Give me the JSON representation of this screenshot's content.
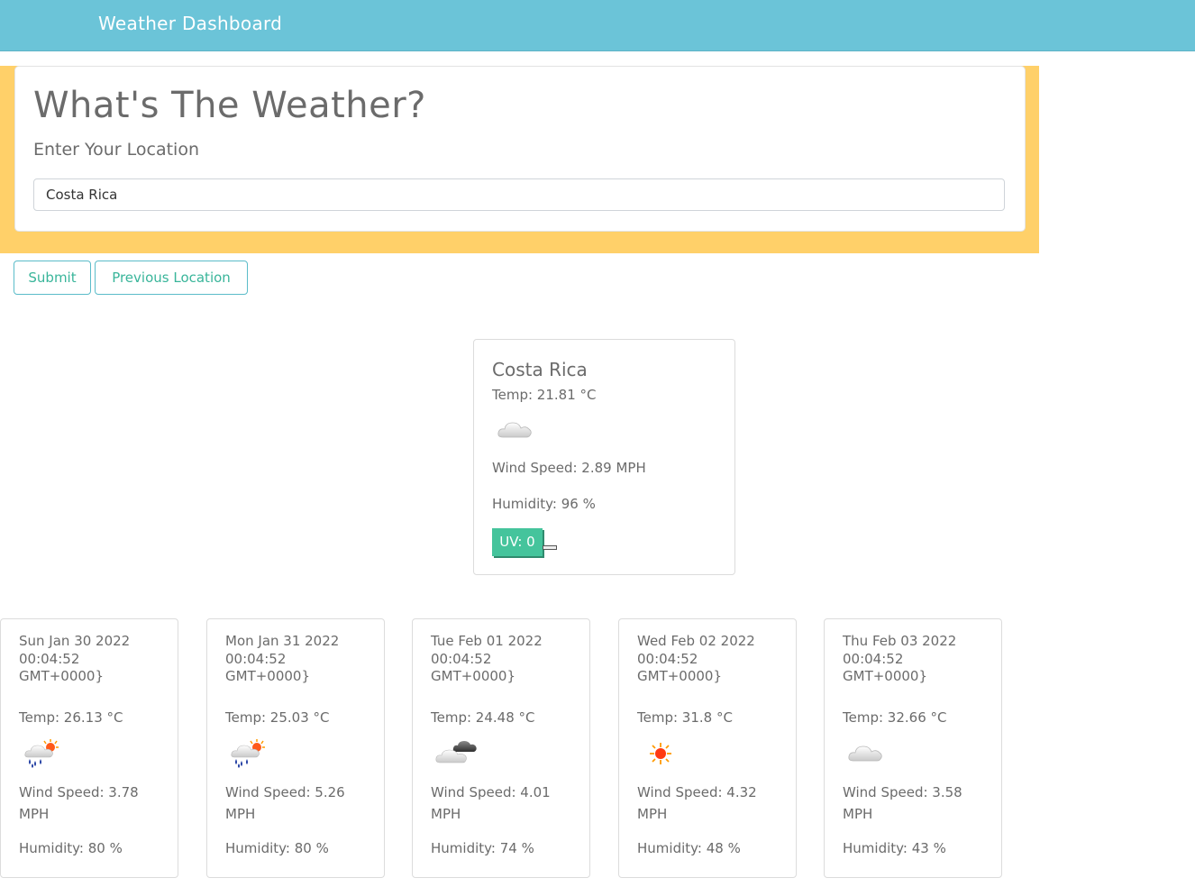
{
  "navbar": {
    "title": "Weather Dashboard"
  },
  "search": {
    "heading": "What's The Weather?",
    "label": "Enter Your Location",
    "input_value": "Costa Rica"
  },
  "buttons": {
    "submit": "Submit",
    "previous": "Previous Location"
  },
  "colors": {
    "navbar": "#6bc4d8",
    "jumbotron": "#ffd069",
    "button_text": "#39b59a",
    "uv_badge": "#45c49c"
  },
  "current": {
    "city": "Costa Rica",
    "temp": "Temp: 21.81 °C",
    "icon": "cloud-icon",
    "wind": "Wind Speed: 2.89 MPH",
    "humidity": "Humidity: 96 %",
    "uv": "UV: 0"
  },
  "forecast": [
    {
      "date": "Sun Jan 30 2022 00:04:52 GMT+0000}",
      "temp": "Temp: 26.13 °C",
      "icon": "rain-sun-icon",
      "wind": "Wind Speed: 3.78 MPH",
      "humidity": "Humidity: 80 %"
    },
    {
      "date": "Mon Jan 31 2022 00:04:52 GMT+0000}",
      "temp": "Temp: 25.03 °C",
      "icon": "rain-sun-icon",
      "wind": "Wind Speed: 5.26 MPH",
      "humidity": "Humidity: 80 %"
    },
    {
      "date": "Tue Feb 01 2022 00:04:52 GMT+0000}",
      "temp": "Temp: 24.48 °C",
      "icon": "broken-clouds-icon",
      "wind": "Wind Speed: 4.01 MPH",
      "humidity": "Humidity: 74 %"
    },
    {
      "date": "Wed Feb 02 2022 00:04:52 GMT+0000}",
      "temp": "Temp: 31.8 °C",
      "icon": "sun-icon",
      "wind": "Wind Speed: 4.32 MPH",
      "humidity": "Humidity: 48 %"
    },
    {
      "date": "Thu Feb 03 2022 00:04:52 GMT+0000}",
      "temp": "Temp: 32.66 °C",
      "icon": "cloud-icon",
      "wind": "Wind Speed: 3.58 MPH",
      "humidity": "Humidity: 43 %"
    }
  ]
}
